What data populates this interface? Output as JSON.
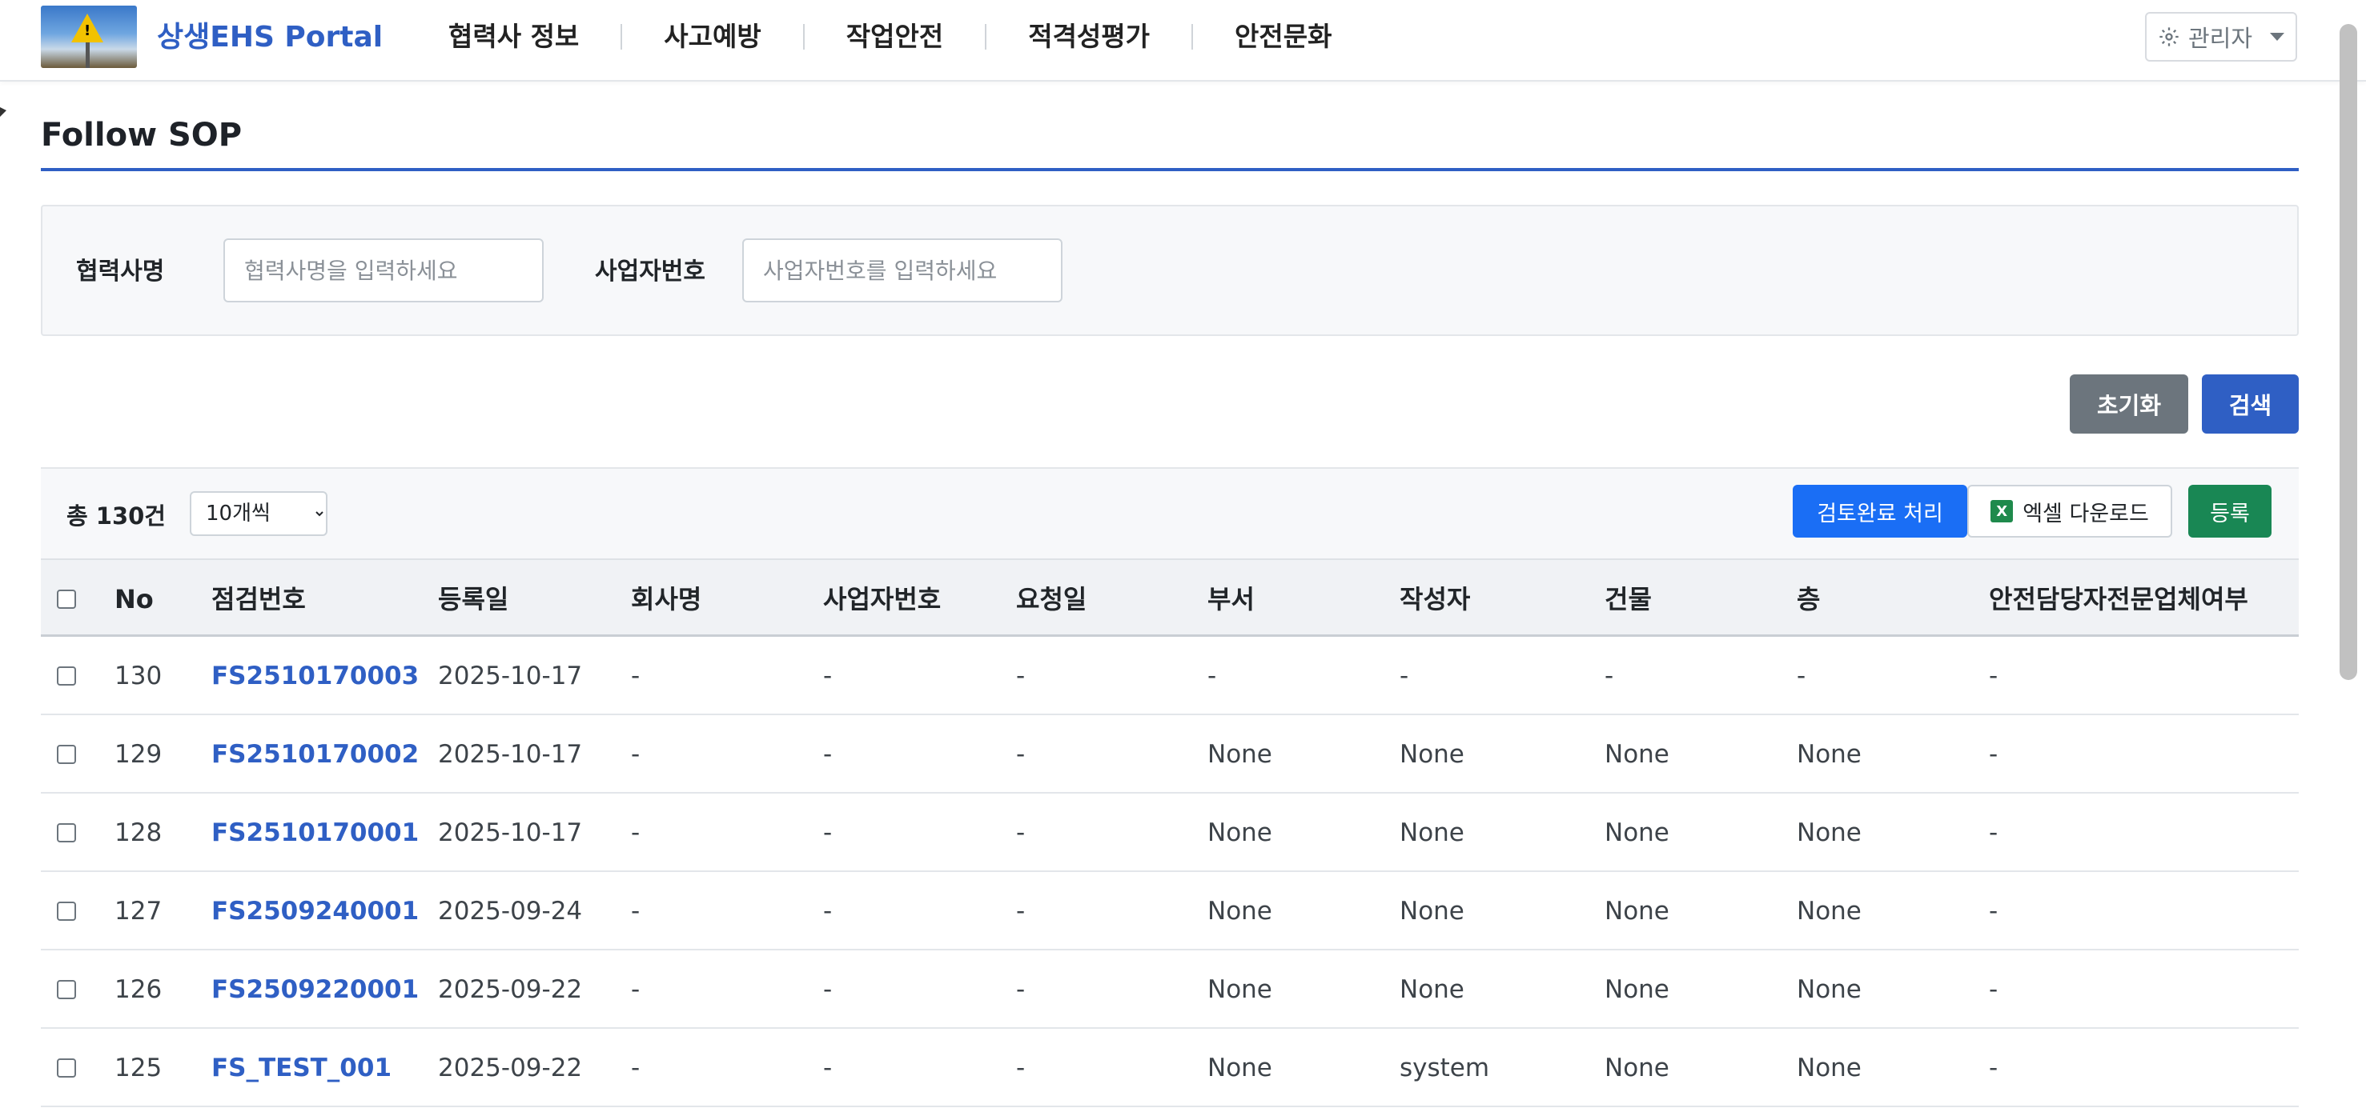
{
  "header": {
    "brand": "상생EHS Portal",
    "nav": [
      "협력사 정보",
      "사고예방",
      "작업안전",
      "적격성평가",
      "안전문화"
    ],
    "admin_label": "관리자"
  },
  "page": {
    "title": "Follow SOP"
  },
  "search": {
    "company_label": "협력사명",
    "company_placeholder": "협력사명을 입력하세요",
    "bizno_label": "사업자번호",
    "bizno_placeholder": "사업자번호를 입력하세요",
    "reset_label": "초기화",
    "search_label": "검색"
  },
  "list": {
    "total_label": "총 130건",
    "page_size": "10개씩",
    "review_label": "검토완료 처리",
    "excel_label": "엑셀 다운로드",
    "excel_icon_letter": "X",
    "register_label": "등록"
  },
  "table": {
    "columns": [
      "No",
      "점검번호",
      "등록일",
      "회사명",
      "사업자번호",
      "요청일",
      "부서",
      "작성자",
      "건물",
      "층",
      "안전담당자전문업체여부"
    ],
    "rows": [
      [
        "130",
        "FS2510170003",
        "2025-10-17",
        "-",
        "-",
        "-",
        "-",
        "-",
        "-",
        "-",
        "-"
      ],
      [
        "129",
        "FS2510170002",
        "2025-10-17",
        "-",
        "-",
        "-",
        "None",
        "None",
        "None",
        "None",
        "-"
      ],
      [
        "128",
        "FS2510170001",
        "2025-10-17",
        "-",
        "-",
        "-",
        "None",
        "None",
        "None",
        "None",
        "-"
      ],
      [
        "127",
        "FS2509240001",
        "2025-09-24",
        "-",
        "-",
        "-",
        "None",
        "None",
        "None",
        "None",
        "-"
      ],
      [
        "126",
        "FS2509220001",
        "2025-09-22",
        "-",
        "-",
        "-",
        "None",
        "None",
        "None",
        "None",
        "-"
      ],
      [
        "125",
        "FS_TEST_001",
        "2025-09-22",
        "-",
        "-",
        "-",
        "None",
        "system",
        "None",
        "None",
        "-"
      ]
    ]
  },
  "colors": {
    "brand": "#2f5fc4",
    "review_button": "#1a6ef5",
    "register_button": "#198754",
    "reset_button": "#6c757d"
  }
}
